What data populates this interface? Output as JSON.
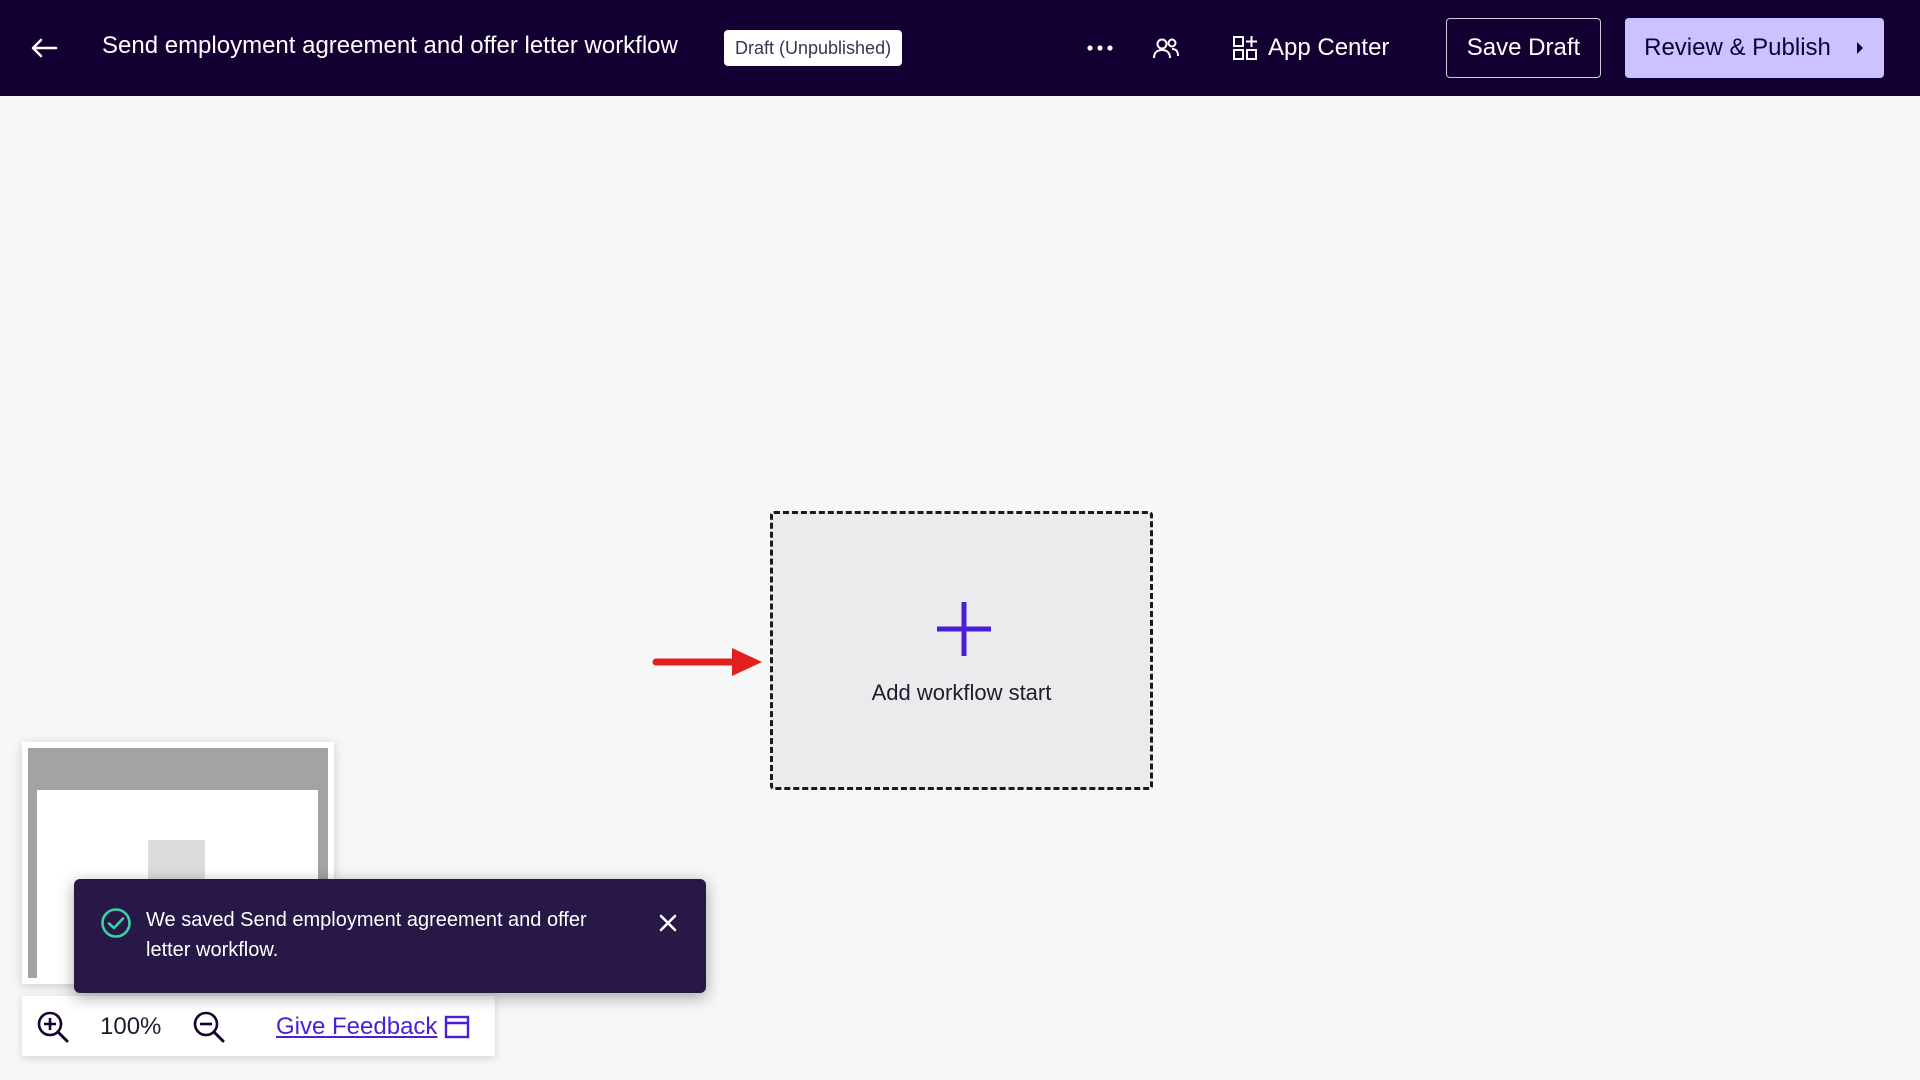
{
  "header": {
    "workflow_title": "Send employment agreement and offer letter workflow",
    "status_badge": "Draft (Unpublished)",
    "app_center_label": "App Center",
    "save_draft_label": "Save Draft",
    "review_publish_label": "Review & Publish"
  },
  "canvas": {
    "start_node_label": "Add workflow start"
  },
  "zoom": {
    "level": "100%",
    "feedback_label": "Give Feedback"
  },
  "toast": {
    "message": "We saved Send employment agreement and offer letter workflow."
  },
  "icons": {
    "back": "arrow-left-icon",
    "more": "ellipsis-icon",
    "collaborators": "users-icon",
    "app_center": "apps-grid-icon",
    "publish_chevron": "caret-right-icon",
    "add": "plus-icon",
    "zoom_in": "zoom-in-icon",
    "zoom_out": "zoom-out-icon",
    "feedback": "feedback-window-icon",
    "success": "check-circle-icon",
    "close": "close-icon"
  },
  "colors": {
    "header_bg": "#130032",
    "primary_accent": "#4a1fd6",
    "publish_button_bg": "#cbc2ff",
    "toast_bg": "#271847",
    "success": "#3ad29f",
    "annotation_arrow": "#e0201f"
  }
}
